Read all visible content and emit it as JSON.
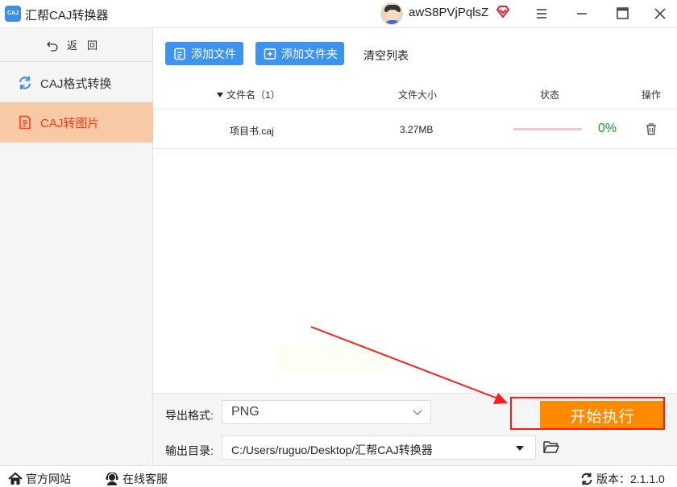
{
  "app": {
    "logo_text": "CAJ",
    "title": "汇帮CAJ转换器",
    "user_name": "awS8PVjPqlsZ"
  },
  "sidebar": {
    "back_label": "返回",
    "items": [
      {
        "label": "CAJ格式转换",
        "icon": "refresh-icon"
      },
      {
        "label": "CAJ转图片",
        "icon": "document-icon",
        "active": true
      }
    ]
  },
  "toolbar": {
    "add_file_label": "添加文件",
    "add_folder_label": "添加文件夹",
    "clear_label": "清空列表"
  },
  "table": {
    "columns": {
      "name": "文件名（1）",
      "size": "文件大小",
      "status": "状态",
      "operation": "操作"
    },
    "rows": [
      {
        "name": "项目书.caj",
        "size": "3.27MB",
        "progress": 0,
        "progress_text": "0%"
      }
    ]
  },
  "settings": {
    "format_label": "导出格式:",
    "format_value": "PNG",
    "dir_label": "输出目录:",
    "dir_value": "C:/Users/ruguo/Desktop/汇帮CAJ转换器"
  },
  "start_button_label": "开始执行",
  "statusbar": {
    "home_label": "官方网站",
    "service_label": "在线客服",
    "version_label": "版本：2.1.1.0"
  },
  "colors": {
    "primary": "#3d94f0",
    "start": "#ff8a00",
    "active_nav_bg": "#f7c9a4",
    "active_nav_text": "#ff3b1a",
    "progress_text": "#1a9a2a",
    "annotation": "#ff1a1a"
  }
}
